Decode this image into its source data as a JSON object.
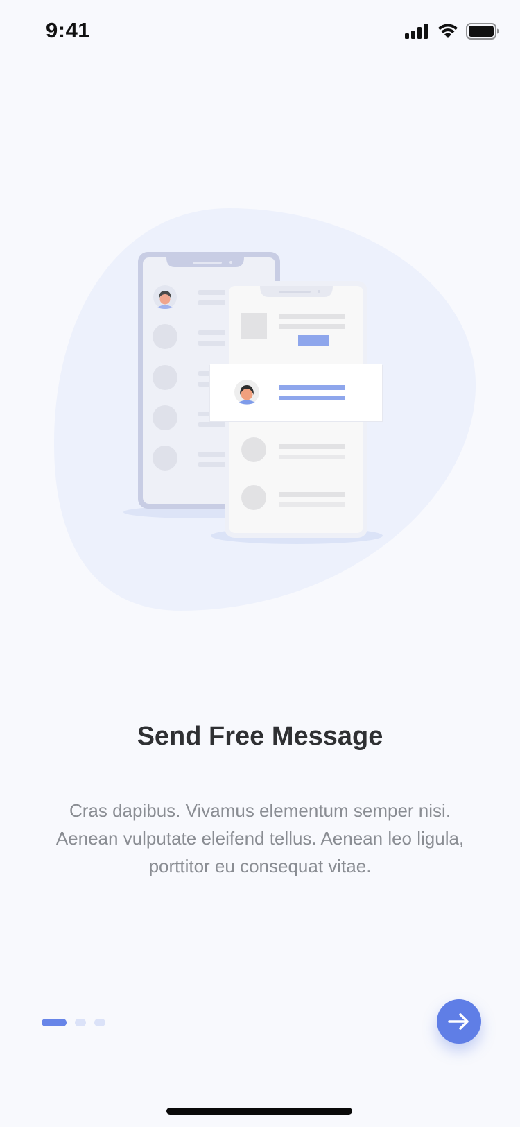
{
  "status_bar": {
    "time": "9:41",
    "icons": [
      "cellular-signal-icon",
      "wifi-icon",
      "battery-icon"
    ]
  },
  "onboarding": {
    "title": "Send Free Message",
    "description": "Cras dapibus. Vivamus elementum semper nisi. Aenean vulputate eleifend tellus. Aenean leo ligula, porttitor eu consequat vitae.",
    "pager": {
      "total": 3,
      "current": 1
    },
    "next_icon": "arrow-right-icon"
  },
  "colors": {
    "background": "#f8f9fd",
    "accent": "#5f7ee6",
    "blob": "#edf1fc",
    "title": "#2f3033",
    "body_text": "#8a8d93"
  }
}
